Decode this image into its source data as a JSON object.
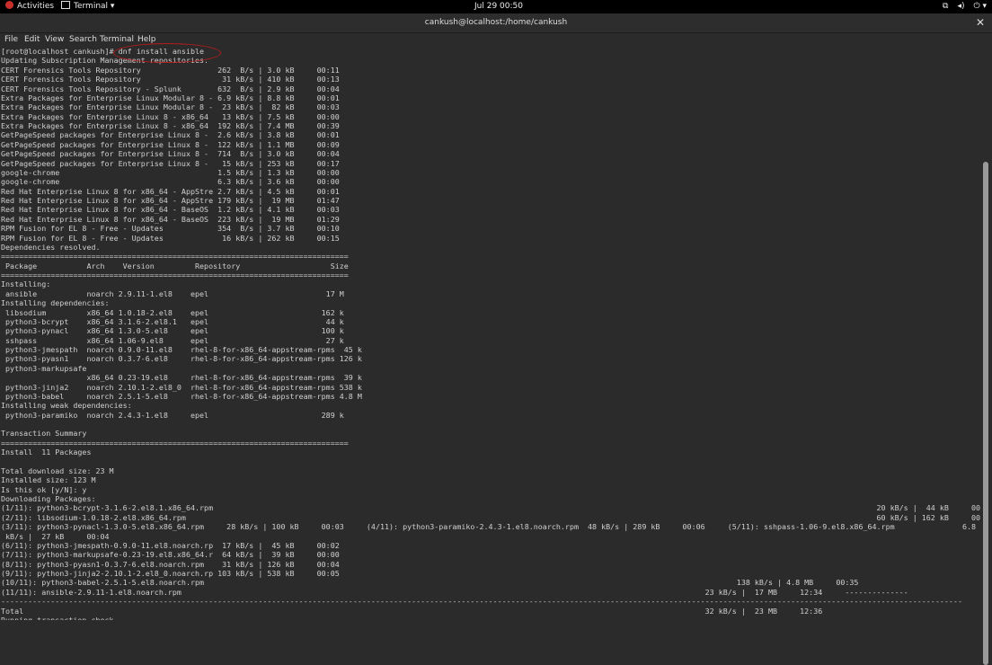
{
  "topbar": {
    "activities": "Activities",
    "app": "Terminal ▾",
    "clock": "Jul 29  00:50",
    "icons": [
      "network-icon",
      "volume-icon",
      "power-icon"
    ]
  },
  "window": {
    "title": "cankush@localhost:/home/cankush",
    "close": "✕"
  },
  "menu": [
    "File",
    "Edit",
    "View",
    "Search",
    "Terminal",
    "Help"
  ],
  "terminal_lines": [
    "[root@localhost cankush]# dnf install ansible",
    "Updating Subscription Management repositories.",
    "CERT Forensics Tools Repository                 262  B/s | 3.0 kB     00:11",
    "CERT Forensics Tools Repository                  31 kB/s | 410 kB     00:13",
    "CERT Forensics Tools Repository - Splunk        632  B/s | 2.9 kB     00:04",
    "Extra Packages for Enterprise Linux Modular 8 - 6.9 kB/s | 8.8 kB     00:01",
    "Extra Packages for Enterprise Linux Modular 8 -  23 kB/s |  82 kB     00:03",
    "Extra Packages for Enterprise Linux 8 - x86_64   13 kB/s | 7.5 kB     00:00",
    "Extra Packages for Enterprise Linux 8 - x86_64  192 kB/s | 7.4 MB     00:39",
    "GetPageSpeed packages for Enterprise Linux 8 -  2.6 kB/s | 3.8 kB     00:01",
    "GetPageSpeed packages for Enterprise Linux 8 -  122 kB/s | 1.1 MB     00:09",
    "GetPageSpeed packages for Enterprise Linux 8 -  714  B/s | 3.0 kB     00:04",
    "GetPageSpeed packages for Enterprise Linux 8 -   15 kB/s | 253 kB     00:17",
    "google-chrome                                   1.5 kB/s | 1.3 kB     00:00",
    "google-chrome                                   6.3 kB/s | 3.6 kB     00:00",
    "Red Hat Enterprise Linux 8 for x86_64 - AppStre 2.7 kB/s | 4.5 kB     00:01",
    "Red Hat Enterprise Linux 8 for x86_64 - AppStre 179 kB/s |  19 MB     01:47",
    "Red Hat Enterprise Linux 8 for x86_64 - BaseOS  1.2 kB/s | 4.1 kB     00:03",
    "Red Hat Enterprise Linux 8 for x86_64 - BaseOS  223 kB/s |  19 MB     01:29",
    "RPM Fusion for EL 8 - Free - Updates            354  B/s | 3.7 kB     00:10",
    "RPM Fusion for EL 8 - Free - Updates             16 kB/s | 262 kB     00:15",
    "Dependencies resolved.",
    "=============================================================================",
    " Package           Arch    Version         Repository                    Size",
    "=============================================================================",
    "Installing:",
    " ansible           noarch 2.9.11-1.el8    epel                          17 M",
    "Installing dependencies:",
    " libsodium         x86_64 1.0.18-2.el8    epel                         162 k",
    " python3-bcrypt    x86_64 3.1.6-2.el8.1   epel                          44 k",
    " python3-pynacl    x86_64 1.3.0-5.el8     epel                         100 k",
    " sshpass           x86_64 1.06-9.el8      epel                          27 k",
    " python3-jmespath  noarch 0.9.0-11.el8    rhel-8-for-x86_64-appstream-rpms  45 k",
    " python3-pyasn1    noarch 0.3.7-6.el8     rhel-8-for-x86_64-appstream-rpms 126 k",
    " python3-markupsafe",
    "                   x86_64 0.23-19.el8     rhel-8-for-x86_64-appstream-rpms  39 k",
    " python3-jinja2    noarch 2.10.1-2.el8_0  rhel-8-for-x86_64-appstream-rpms 538 k",
    " python3-babel     noarch 2.5.1-5.el8     rhel-8-for-x86_64-appstream-rpms 4.8 M",
    "Installing weak dependencies:",
    " python3-paramiko  noarch 2.4.3-1.el8     epel                         289 k",
    "",
    "Transaction Summary",
    "=============================================================================",
    "Install  11 Packages",
    "",
    "Total download size: 23 M",
    "Installed size: 123 M",
    "Is this ok [y/N]: y",
    "Downloading Packages:",
    "(1/11): python3-bcrypt-3.1.6-2.el8.1.x86_64.rpm                                                                                                                                                   20 kB/s |  44 kB     00:02",
    "(2/11): libsodium-1.0.18-2.el8.x86_64.rpm                                                                                                                                                         60 kB/s | 162 kB     00:02",
    "(3/11): python3-pynacl-1.3.0-5.el8.x86_64.rpm     28 kB/s | 100 kB     00:03     (4/11): python3-paramiko-2.4.3-1.el8.noarch.rpm  48 kB/s | 289 kB     00:06     (5/11): sshpass-1.06-9.el8.x86_64.rpm               6.8",
    " kB/s |  27 kB     00:04",
    "(6/11): python3-jmespath-0.9.0-11.el8.noarch.rp  17 kB/s |  45 kB     00:02",
    "(7/11): python3-markupsafe-0.23-19.el8.x86_64.r  64 kB/s |  39 kB     00:00",
    "(8/11): python3-pyasn1-0.3.7-6.el8.noarch.rpm    31 kB/s | 126 kB     00:04",
    "(9/11): python3-jinja2-2.10.1-2.el8_0.noarch.rp 103 kB/s | 538 kB     00:05",
    "(10/11): python3-babel-2.5.1-5.el8.noarch.rpm                                                                                                                      138 kB/s | 4.8 MB     00:35",
    "(11/11): ansible-2.9.11-1.el8.noarch.rpm                                                                                                                    23 kB/s |  17 MB     12:34     --------------",
    "---------------------------------------------------------------------------------------------------------------------------------------------------------------------------------------------------------------------",
    "Total                                                                                                                                                       32 kB/s |  23 MB     12:36",
    "Running transaction check"
  ],
  "colors": {
    "background": "#2b2b2b",
    "text": "#d0d0d0",
    "annotation": "#b71c1c"
  }
}
